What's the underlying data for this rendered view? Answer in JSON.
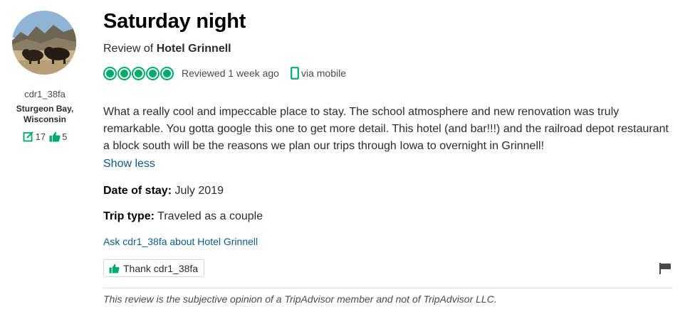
{
  "member": {
    "username": "cdr1_38fa",
    "location": "Sturgeon Bay, Wisconsin",
    "review_count": "17",
    "helpful_count": "5"
  },
  "review": {
    "title": "Saturday night",
    "review_of_prefix": "Review of ",
    "hotel_name": "Hotel Grinnell",
    "bubble_rating": 5,
    "reviewed_date": "Reviewed 1 week ago",
    "via": "via mobile",
    "text": "What a really cool and impeccable place to stay. The school atmosphere and new renovation was truly remarkable. You gotta google this one to get more detail. This hotel (and bar!!!) and the railroad depot restaurant a block south will be the reasons we plan our trips through Iowa to overnight in Grinnell!",
    "show_less": "Show less",
    "date_of_stay_label": "Date of stay:",
    "date_of_stay_value": " July 2019",
    "trip_type_label": "Trip type:",
    "trip_type_value": " Traveled as a couple",
    "ask_link": "Ask cdr1_38fa about Hotel Grinnell",
    "thank_button": "Thank cdr1_38fa",
    "disclaimer": "This review is the subjective opinion of a TripAdvisor member and not of TripAdvisor LLC."
  },
  "colors": {
    "accent_green": "#00aa6c",
    "link_blue": "#0a5b8c",
    "text": "#2c2c2c"
  },
  "icons": {
    "review_count": "review-edit-icon",
    "helpful_count": "thumbs-up-icon",
    "mobile": "mobile-phone-icon",
    "thank": "thumbs-up-icon",
    "report": "flag-icon"
  }
}
